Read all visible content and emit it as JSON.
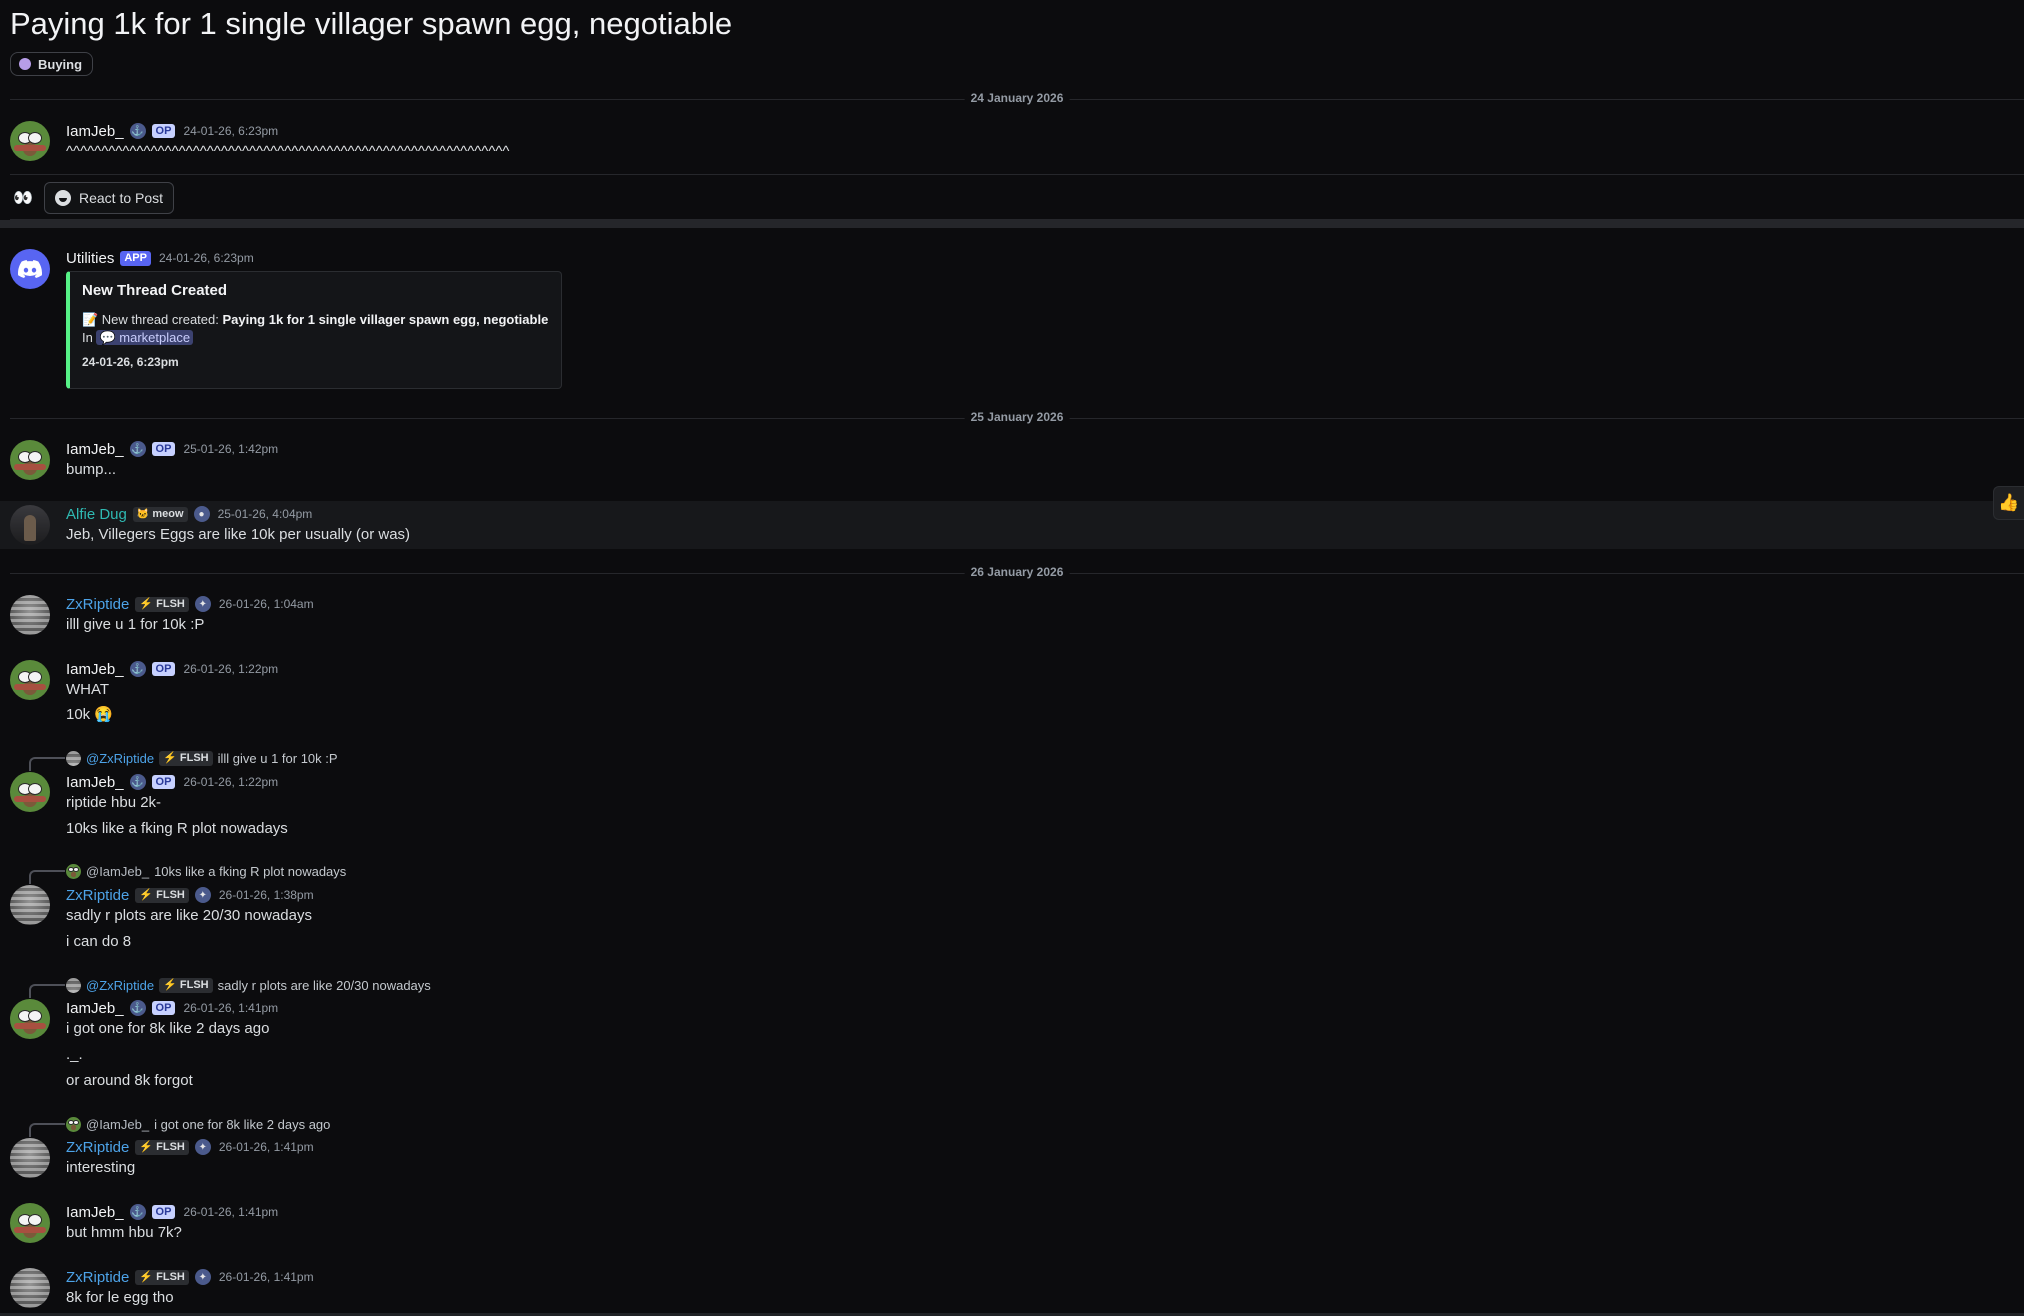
{
  "thread": {
    "title": "Paying 1k for 1 single villager spawn egg, negotiable",
    "tag": "Buying",
    "tag_color": "#b79de8"
  },
  "dates": {
    "d1": "24 January 2026",
    "d2": "25 January 2026",
    "d3": "26 January 2026"
  },
  "badges": {
    "op": "OP",
    "app": "APP",
    "meow": "meow",
    "flsh": "FLSH"
  },
  "reactions": {
    "emoji": "👀",
    "react_label": "React to Post",
    "thumb": "👍"
  },
  "messages": [
    {
      "author": "IamJeb_",
      "time": "24-01-26, 6:23pm",
      "lines": [
        "^^^^^^^^^^^^^^^^^^^^^^^^^^^^^^^^^^^^^^^^^^^^^^^^^^^^^^^^^^^^^^^"
      ]
    },
    {
      "author": "Utilities",
      "time": "24-01-26, 6:23pm",
      "embed": {
        "title": "New Thread Created",
        "prefix": "📝 New thread created: ",
        "thread_name": "Paying 1k for 1 single villager spawn egg, negotiable",
        "in_label": "In",
        "channel": "marketplace",
        "footer": "24-01-26, 6:23pm"
      }
    },
    {
      "author": "IamJeb_",
      "time": "25-01-26, 1:42pm",
      "lines": [
        "bump..."
      ]
    },
    {
      "author": "Alfie Dug",
      "time": "25-01-26, 4:04pm",
      "lines": [
        "Jeb, Villegers Eggs are like 10k per usually (or was)"
      ]
    },
    {
      "author": "ZxRiptide",
      "time": "26-01-26, 1:04am",
      "lines": [
        "illl give u 1 for 10k :P"
      ]
    },
    {
      "author": "IamJeb_",
      "time": "26-01-26, 1:22pm",
      "lines": [
        "WHAT",
        "10k",
        "😭"
      ]
    },
    {
      "reply_to": "@ZxRiptide",
      "reply_text": "illl give u 1 for 10k :P",
      "author": "IamJeb_",
      "time": "26-01-26, 1:22pm",
      "lines": [
        "riptide hbu 2k-",
        "10ks like a fking R plot nowadays"
      ]
    },
    {
      "reply_to": "@IamJeb_",
      "reply_text": "10ks like a fking R plot nowadays",
      "author": "ZxRiptide",
      "time": "26-01-26, 1:38pm",
      "lines": [
        "sadly r plots are like 20/30 nowadays",
        "i can do 8"
      ]
    },
    {
      "reply_to": "@ZxRiptide",
      "reply_text": "sadly r plots are like 20/30 nowadays",
      "author": "IamJeb_",
      "time": "26-01-26, 1:41pm",
      "lines": [
        "i got one for 8k like 2 days ago",
        "._.",
        "or around 8k forgot"
      ]
    },
    {
      "reply_to": "@IamJeb_",
      "reply_text": "i got one for 8k like 2 days ago",
      "author": "ZxRiptide",
      "time": "26-01-26, 1:41pm",
      "lines": [
        "interesting"
      ]
    },
    {
      "author": "IamJeb_",
      "time": "26-01-26, 1:41pm",
      "lines": [
        "but hmm hbu 7k?"
      ]
    },
    {
      "author": "ZxRiptide",
      "time": "26-01-26, 1:41pm",
      "lines": [
        "8k for le egg tho"
      ]
    }
  ]
}
